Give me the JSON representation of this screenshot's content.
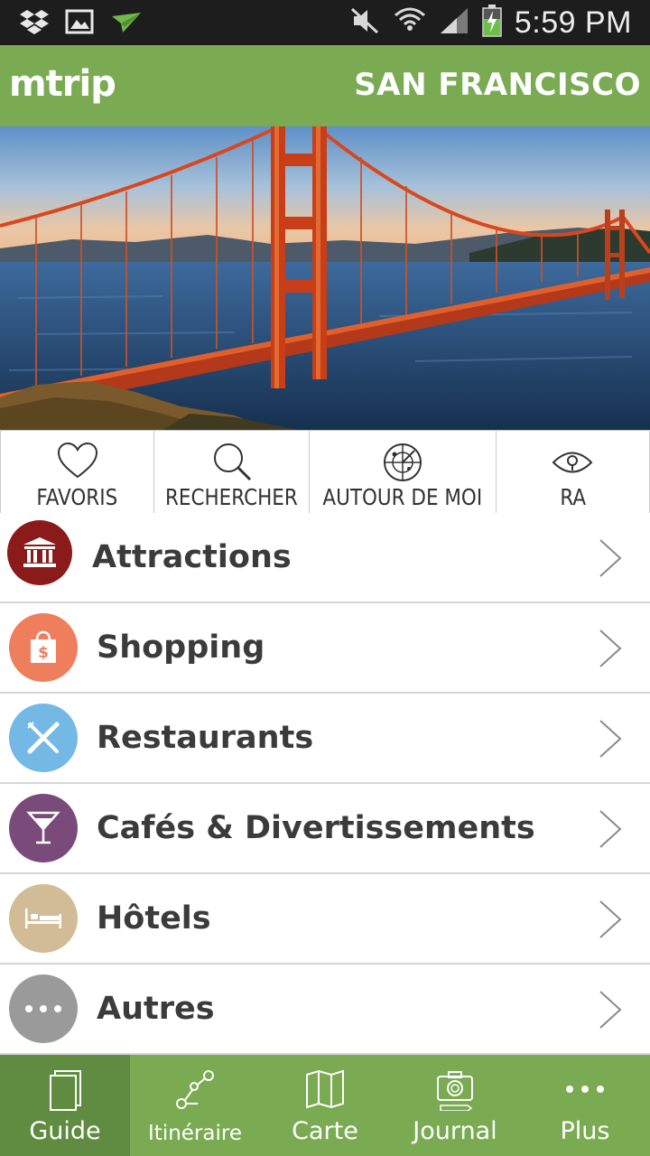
{
  "status_bar": {
    "time": "5:59 PM",
    "left_icons": [
      "dropbox-icon",
      "image-icon",
      "paper-plane-icon"
    ],
    "right_icons": [
      "mute-icon",
      "wifi-icon",
      "signal-icon",
      "battery-charging-icon"
    ]
  },
  "header": {
    "brand": "mtrip",
    "city": "SAN FRANCISCO"
  },
  "quick_actions": [
    {
      "label": "FAVORIS",
      "icon": "heart-icon"
    },
    {
      "label": "RECHERCHER",
      "icon": "search-icon"
    },
    {
      "label": "AUTOUR DE MOI",
      "icon": "radar-icon"
    },
    {
      "label": "RA",
      "icon": "eye-icon"
    }
  ],
  "categories": [
    {
      "label": "Attractions",
      "icon": "museum-icon",
      "color": "#8b1a1a"
    },
    {
      "label": "Shopping",
      "icon": "shopping-bag-icon",
      "color": "#ef7e5c"
    },
    {
      "label": "Restaurants",
      "icon": "fork-knife-icon",
      "color": "#74b9e5"
    },
    {
      "label": "Cafés & Divertissements",
      "icon": "cocktail-icon",
      "color": "#7a4a7a"
    },
    {
      "label": "Hôtels",
      "icon": "bed-icon",
      "color": "#d2bc97"
    },
    {
      "label": "Autres",
      "icon": "more-icon",
      "color": "#9a9a9a"
    }
  ],
  "bottom_nav": {
    "active": "Guide",
    "tabs": [
      {
        "label": "Guide",
        "icon": "guide-book-icon"
      },
      {
        "label": "Itinéraire",
        "icon": "route-icon"
      },
      {
        "label": "Carte",
        "icon": "map-icon"
      },
      {
        "label": "Journal",
        "icon": "camera-icon"
      },
      {
        "label": "Plus",
        "icon": "more-icon"
      }
    ]
  },
  "colors": {
    "brand_green": "#7aab53",
    "active_tab_green": "#5f8c40"
  }
}
